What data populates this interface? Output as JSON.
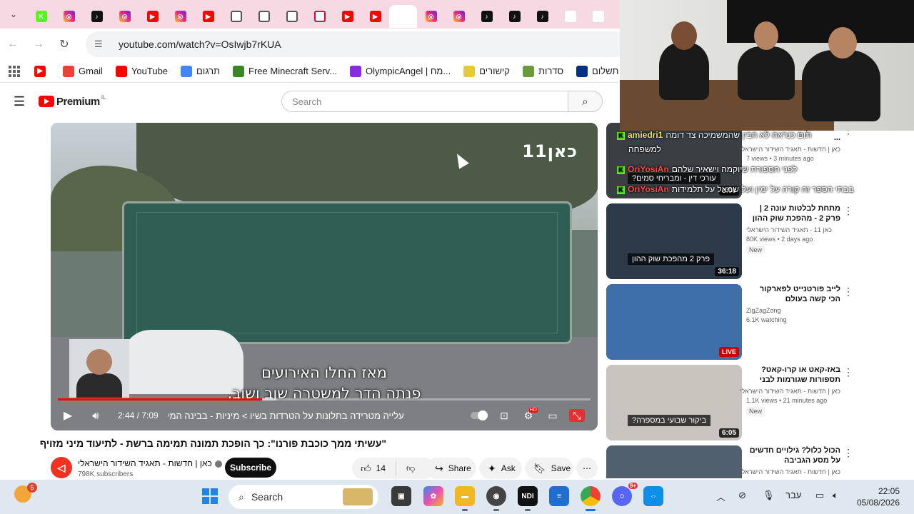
{
  "browser": {
    "url": "youtube.com/watch?v=OsIwjb7rKUA",
    "tabs": [
      {
        "icon": "kick-icon"
      },
      {
        "icon": "instagram-icon"
      },
      {
        "icon": "tiktok-icon"
      },
      {
        "icon": "instagram-icon"
      },
      {
        "icon": "youtube-icon"
      },
      {
        "icon": "instagram-icon"
      },
      {
        "icon": "youtube-icon"
      },
      {
        "icon": "github-icon"
      },
      {
        "icon": "github-icon"
      },
      {
        "icon": "github-icon"
      },
      {
        "icon": "roblox-icon"
      },
      {
        "icon": "youtube-icon"
      },
      {
        "icon": "youtube-icon"
      },
      {
        "icon": "close-icon",
        "active": true
      },
      {
        "icon": "instagram-icon"
      },
      {
        "icon": "instagram-icon"
      },
      {
        "icon": "tiktok-icon"
      },
      {
        "icon": "tiktok-icon"
      },
      {
        "icon": "tiktok-icon"
      },
      {
        "icon": "google-icon"
      },
      {
        "icon": "google-icon"
      }
    ],
    "bookmarks": [
      {
        "label": "Gmail",
        "color": "#ea4335",
        "icon": "gmail-icon"
      },
      {
        "label": "YouTube",
        "color": "#ff0000",
        "icon": "youtube-icon"
      },
      {
        "label": "תרגום",
        "color": "#4285f4",
        "icon": "translate-icon"
      },
      {
        "label": "Free Minecraft Serv...",
        "color": "#3c8527",
        "icon": "minecraft-icon"
      },
      {
        "label": "OlympicAngel | מח...",
        "color": "#8a2be2",
        "icon": "avatar-icon"
      },
      {
        "label": "קישורים",
        "color": "#e8c840",
        "icon": "star-icon"
      },
      {
        "label": "סדרות",
        "color": "#6a9a3a",
        "icon": "folder-icon"
      },
      {
        "label": "תשלום",
        "color": "#003087",
        "icon": "paypal-icon"
      }
    ]
  },
  "youtube": {
    "logo_text": "Premium",
    "country_code": "IL",
    "search_placeholder": "Search",
    "video": {
      "title": "\"עשיתי ממך כוכבת פורנו\": כך הופכת תמונה תמימה ברשת - לתיעוד מיני מזויף",
      "channel": "כאן | חדשות - תאגיד השידור הישראלי",
      "subscribers": "798K subscribers",
      "subscribe_label": "Subscribe",
      "likes": "14",
      "share_label": "Share",
      "ask_label": "Ask",
      "save_label": "Save",
      "current_time": "2:44",
      "duration": "7:09",
      "progress": 0.383,
      "buffered": 0.41,
      "chapter": "עלייה מטרידה בתלונות על הטרדות בשיו > מיניות - בבינה המלאכותית",
      "subtitle_line1": "מאז החלו האירועים",
      "subtitle_line2": "פנתה הדר למשטרה שוב ושוב.",
      "broadcaster_logo": "כאן11"
    },
    "recommendations": [
      {
        "title": "עורכי הדין מבריחים סמים ...",
        "channel": "כאן | חדשות - תאגיד השידור הישראלי",
        "meta": "7 views • 3 minutes ago",
        "duration": "3:00",
        "badge": "",
        "thumb_caption": "עורכי דין - ומבריחי סמים?",
        "thumb_color": "#3a3f44"
      },
      {
        "title": "מתחת לבלטות עונה 2 | פרק 2 - מהפכת שוק ההון",
        "channel": "כאן 11 - תאגיד השידור הישראלי",
        "meta": "80K views • 2 days ago",
        "duration": "36:18",
        "badge": "New",
        "thumb_caption": "פרק 2 מהפכת שוק ההון",
        "thumb_color": "#2c3a4a"
      },
      {
        "title": "לייב פורטנייט לפארקור הכי קשה בעולם",
        "channel": "ZigZagZong",
        "meta": "6.1K watching",
        "duration": "LIVE",
        "badge": "",
        "thumb_caption": "",
        "thumb_color": "#3f6fa8"
      },
      {
        "title": "באז-קאט או קרו-קאט? תספורות שגורמות לבני הנוער...",
        "channel": "כאן | חדשות - תאגיד השידור הישראלי",
        "meta": "1.1K views • 21 minutes ago",
        "duration": "6:05",
        "badge": "New",
        "thumb_caption": "ביקור שבועי במספרה?",
        "thumb_color": "#c9c4bd"
      },
      {
        "title": "הכול כלול? גילויים חדשים על מסע הגביבה המשפחתי באילת",
        "channel": "כאן | חדשות - תאגיד השידור הישראלי",
        "meta": "",
        "duration": "",
        "badge": "",
        "thumb_caption": "",
        "thumb_color": "#50606e"
      }
    ]
  },
  "stream_overlay": {
    "chat": [
      {
        "user": "amiedri1",
        "message": "תום כנראה לא הבין שהמשמיכה צד דומה"
      },
      {
        "user": "",
        "message": "למשפחה"
      },
      {
        "user": "OriYosiAn",
        "message": "לפני חספורת שיוקמה וישאיר שלהם"
      },
      {
        "user": "OriYosiAn",
        "message": "בבתי הספר זה קורה על ימין ועל שמאל על תלמידות"
      }
    ]
  },
  "taskbar": {
    "notification_count": "5",
    "search_label": "Search",
    "language": "עבר",
    "time": "22:05",
    "date": "05/08/2026",
    "discord_badge": "9+"
  }
}
